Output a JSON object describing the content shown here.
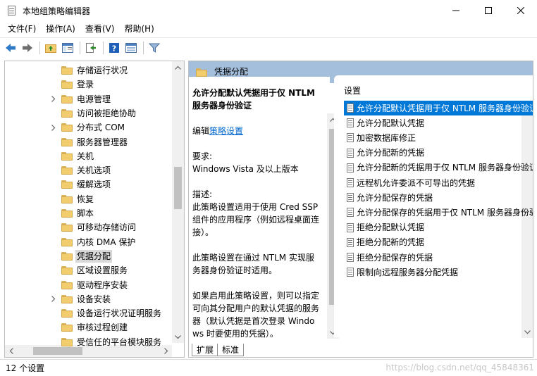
{
  "window": {
    "title": "本地组策略编辑器"
  },
  "menu": [
    "文件(F)",
    "操作(A)",
    "查看(V)",
    "帮助(H)"
  ],
  "tree": {
    "items": [
      {
        "label": "存储运行状况",
        "expandable": false
      },
      {
        "label": "登录",
        "expandable": false
      },
      {
        "label": "电源管理",
        "expandable": true
      },
      {
        "label": "访问被拒绝协助",
        "expandable": false
      },
      {
        "label": "分布式 COM",
        "expandable": true
      },
      {
        "label": "服务器管理器",
        "expandable": false
      },
      {
        "label": "关机",
        "expandable": false
      },
      {
        "label": "关机选项",
        "expandable": false
      },
      {
        "label": "缓解选项",
        "expandable": false
      },
      {
        "label": "恢复",
        "expandable": false
      },
      {
        "label": "脚本",
        "expandable": false
      },
      {
        "label": "可移动存储访问",
        "expandable": false
      },
      {
        "label": "内核 DMA 保护",
        "expandable": false
      },
      {
        "label": "凭据分配",
        "expandable": false,
        "selected": true
      },
      {
        "label": "区域设置服务",
        "expandable": false
      },
      {
        "label": "驱动程序安装",
        "expandable": false
      },
      {
        "label": "设备安装",
        "expandable": true
      },
      {
        "label": "设备运行状况证明服务",
        "expandable": false
      },
      {
        "label": "审核过程创建",
        "expandable": false
      },
      {
        "label": "受信任的平台模块服务",
        "expandable": false
      }
    ]
  },
  "right": {
    "header": "凭据分配",
    "description": {
      "title": "允许分配默认凭据用于仅 NTLM 服务器身份验证",
      "edit_prefix": "编辑",
      "edit_link": "策略设置",
      "req_label": "要求:",
      "req_value": "Windows Vista 及以上版本",
      "desc_label": "描述:",
      "desc_p1": "此策略设置适用于使用 Cred SSP 组件的应用程序（例如远程桌面连接）。",
      "desc_p2": "此策略设置在通过 NTLM 实现服务器身份验证时适用。",
      "desc_p3": "如果启用此策略设置，则可以指定可向其分配用户的默认凭据的服务器（默认凭据是首次登录 Windows 时要使用的凭据）。"
    },
    "list_header": "设置",
    "settings": [
      {
        "label": "允许分配默认凭据用于仅 NTLM 服务器身份验证",
        "selected": true
      },
      {
        "label": "允许分配默认凭据"
      },
      {
        "label": "加密数据库修正"
      },
      {
        "label": "允许分配新的凭据"
      },
      {
        "label": "允许分配新的凭据用于仅 NTLM 服务器身份验证"
      },
      {
        "label": "远程机允许委派不可导出的凭据"
      },
      {
        "label": "允许分配保存的凭据"
      },
      {
        "label": "允许分配保存的凭据用于仅 NTLM 服务器身份验证"
      },
      {
        "label": "拒绝分配默认凭据"
      },
      {
        "label": "拒绝分配新的凭据"
      },
      {
        "label": "拒绝分配保存的凭据"
      },
      {
        "label": "限制向远程服务器分配凭据"
      }
    ],
    "tabs": [
      "扩展",
      "标准"
    ]
  },
  "status": {
    "text": "12 个设置"
  },
  "watermark": "https://blog.csdn.net/qq_45848361"
}
